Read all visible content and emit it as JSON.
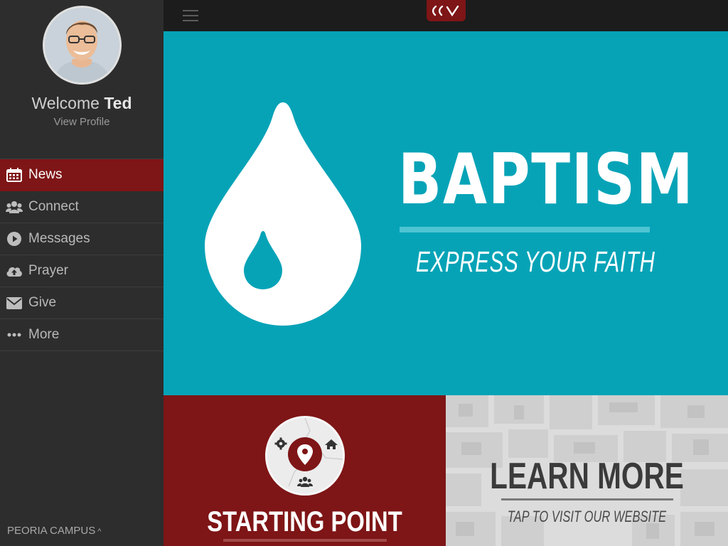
{
  "app": {
    "brand_color": "#7e1516",
    "accent_color": "#06a3b7"
  },
  "sidebar": {
    "welcome_prefix": "Welcome",
    "user_name": "Ted",
    "view_profile": "View Profile",
    "items": [
      {
        "label": "News",
        "icon": "calendar-icon",
        "active": true
      },
      {
        "label": "Connect",
        "icon": "users-icon",
        "active": false
      },
      {
        "label": "Messages",
        "icon": "play-circle-icon",
        "active": false
      },
      {
        "label": "Prayer",
        "icon": "cloud-upload-icon",
        "active": false
      },
      {
        "label": "Give",
        "icon": "envelope-icon",
        "active": false
      },
      {
        "label": "More",
        "icon": "ellipsis-icon",
        "active": false
      }
    ],
    "campus": "PEORIA CAMPUS",
    "campus_chevron": "^"
  },
  "hero": {
    "title": "BAPTISM",
    "subtitle": "EXPRESS YOUR FAITH"
  },
  "tiles": {
    "starting_point": {
      "title": "STARTING POINT"
    },
    "learn_more": {
      "title": "LEARN MORE",
      "subtitle": "TAP TO VISIT OUR WEBSITE"
    }
  }
}
